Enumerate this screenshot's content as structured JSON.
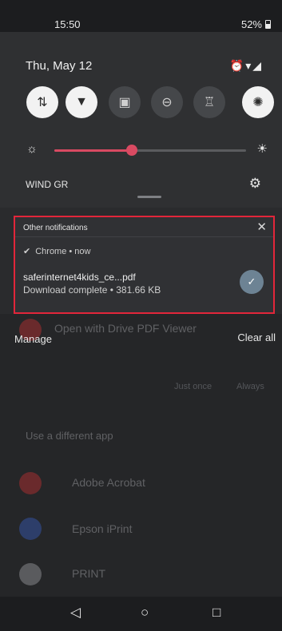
{
  "status_bar": {
    "time": "15:50",
    "battery": "52%"
  },
  "quick_settings": {
    "date": "Thu, May 12",
    "status_icons": "⏰▾◢",
    "tiles": [
      {
        "name": "mobile-data",
        "icon": "⇅",
        "on": true
      },
      {
        "name": "wifi",
        "icon": "▼",
        "on": true
      },
      {
        "name": "battery-saver",
        "icon": "▣",
        "on": false
      },
      {
        "name": "do-not-disturb",
        "icon": "⊖",
        "on": false
      },
      {
        "name": "flashlight",
        "icon": "♖",
        "on": false
      },
      {
        "name": "auto-rotate",
        "icon": "✺",
        "on": true
      }
    ],
    "brightness_level": 0.4,
    "carrier": "WIND GR"
  },
  "notification": {
    "header": "Other notifications",
    "app": "Chrome • now",
    "title": "saferinternet4kids_ce...pdf",
    "body": "Download complete • 381.66 KB"
  },
  "actions": {
    "manage": "Manage",
    "clear_all": "Clear all"
  },
  "background_sheet": {
    "open_with": "Open with Drive PDF Viewer",
    "just_once": "Just once",
    "always": "Always",
    "use_different_app": "Use a different app",
    "apps": [
      "Adobe Acrobat",
      "Epson iPrint",
      "PRINT"
    ]
  },
  "nav": {
    "back": "◁",
    "home": "○",
    "recents": "□"
  }
}
